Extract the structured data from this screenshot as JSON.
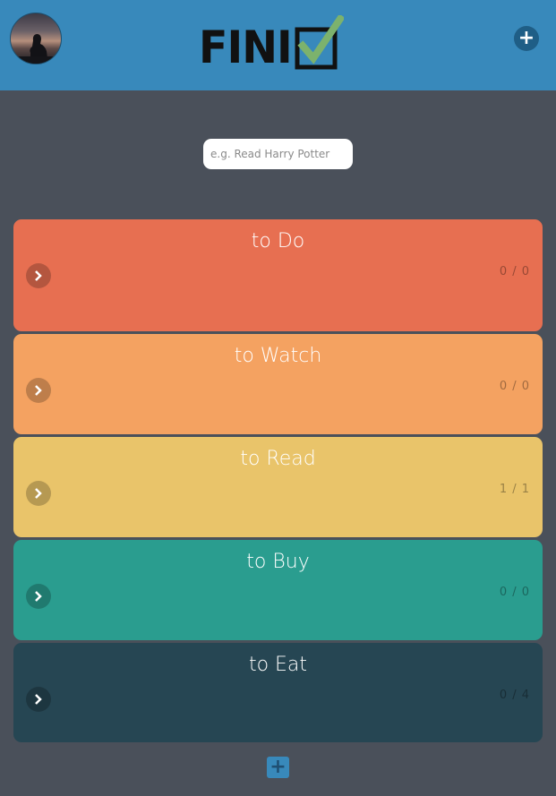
{
  "header": {
    "logo_text": "FINI",
    "add_label": "+"
  },
  "search": {
    "placeholder": "e.g. Read Harry Potter",
    "value": ""
  },
  "lists": [
    {
      "title": "to Do",
      "count": "0 / 0",
      "color": "#e76f51"
    },
    {
      "title": "to Watch",
      "count": "0 / 0",
      "color": "#f4a261"
    },
    {
      "title": "to Read",
      "count": "1 / 1",
      "color": "#e9c46a"
    },
    {
      "title": "to Buy",
      "count": "0 / 0",
      "color": "#2a9d8f"
    },
    {
      "title": "to Eat",
      "count": "0 / 4",
      "color": "#264653"
    }
  ],
  "footer": {
    "add_label": "+"
  },
  "colors": {
    "header": "#3889bb",
    "background": "#4a505a",
    "logo_check": "#7cb26d"
  }
}
